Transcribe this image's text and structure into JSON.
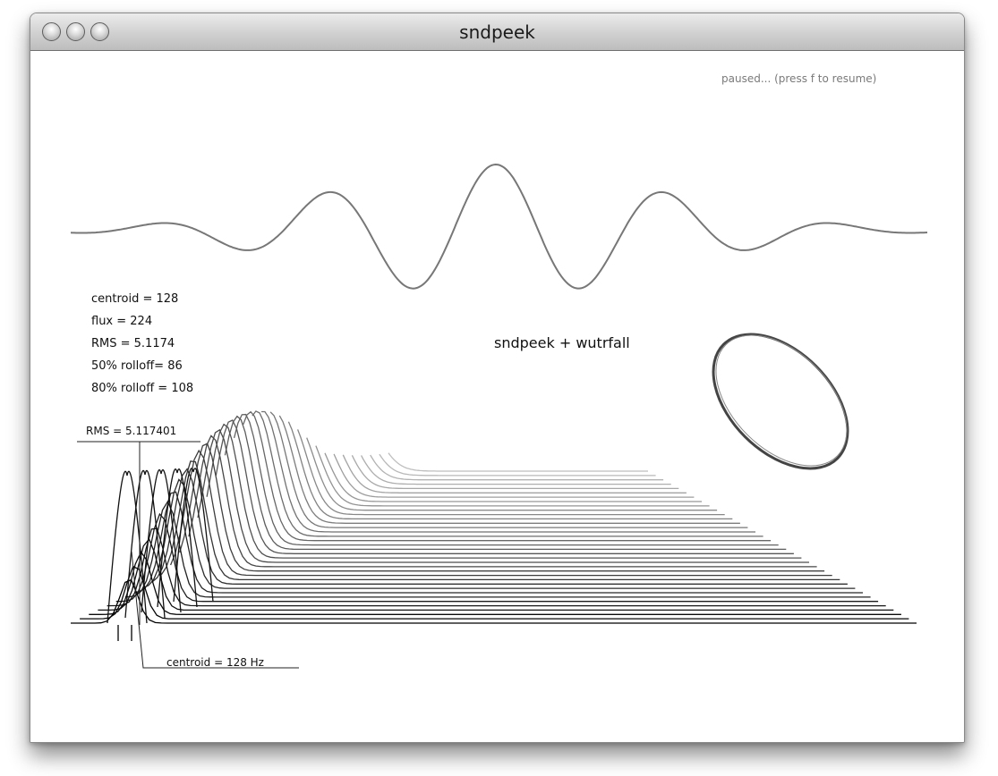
{
  "window": {
    "title": "sndpeek"
  },
  "status": {
    "paused_text": "paused... (press f to resume)"
  },
  "features": [
    "centroid = 128",
    "flux = 224",
    "RMS = 5.1174",
    "50% rolloff= 86",
    "80% rolloff = 108"
  ],
  "banner": "sndpeek + wutrfall",
  "annotations": {
    "rms": "RMS = 5.117401",
    "centroid": "centroid = 128 Hz"
  },
  "colors": {
    "waveform": "#777777",
    "spectrum": "#000000",
    "lissajous": "#555555"
  }
}
